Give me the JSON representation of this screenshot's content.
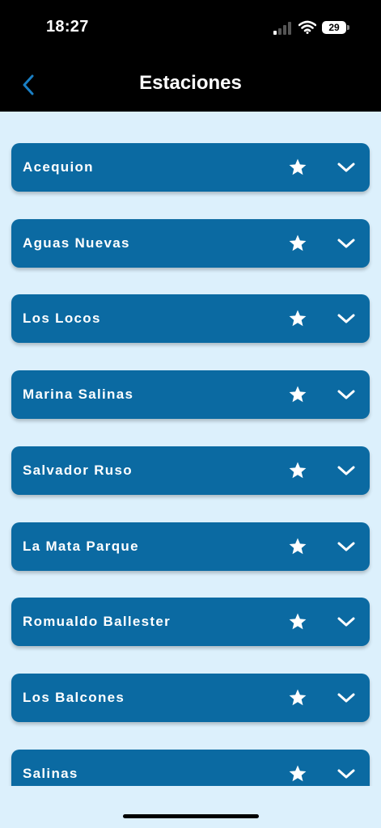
{
  "status_bar": {
    "time": "18:27",
    "battery": "29"
  },
  "nav": {
    "title": "Estaciones"
  },
  "stations": [
    {
      "name": "Acequion"
    },
    {
      "name": "Aguas Nuevas"
    },
    {
      "name": "Los Locos"
    },
    {
      "name": "Marina Salinas"
    },
    {
      "name": "Salvador Ruso"
    },
    {
      "name": "La Mata Parque"
    },
    {
      "name": "Romualdo Ballester"
    },
    {
      "name": "Los Balcones"
    },
    {
      "name": "Salinas"
    }
  ],
  "colors": {
    "header_bg": "#000000",
    "page_bg": "#dcf0fc",
    "card_bg": "#0b6aa2",
    "back_accent": "#1a7fc4"
  },
  "icons": {
    "favorite": "star-icon",
    "expand": "chevron-down-icon",
    "back": "chevron-left-icon"
  }
}
